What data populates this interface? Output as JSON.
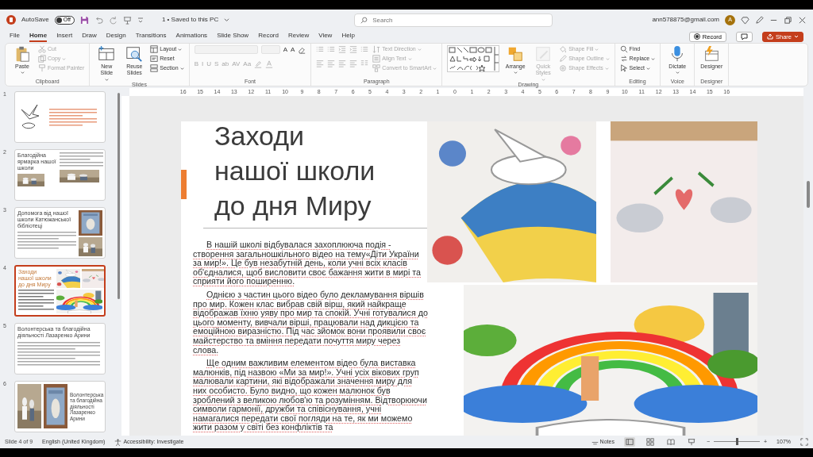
{
  "title_bar": {
    "autosave_label": "AutoSave",
    "autosave": {
      "on": false,
      "label": "Off"
    },
    "document": "1 • Saved to this PC",
    "search": {
      "placeholder": "Search"
    },
    "account": "ann578875@gmail.com",
    "avatar": "A"
  },
  "ribbon_tabs": [
    {
      "label": "File",
      "selected": false
    },
    {
      "label": "Home",
      "selected": true
    },
    {
      "label": "Insert",
      "selected": false
    },
    {
      "label": "Draw",
      "selected": false
    },
    {
      "label": "Design",
      "selected": false
    },
    {
      "label": "Transitions",
      "selected": false
    },
    {
      "label": "Animations",
      "selected": false
    },
    {
      "label": "Slide Show",
      "selected": false
    },
    {
      "label": "Record",
      "selected": false
    },
    {
      "label": "Review",
      "selected": false
    },
    {
      "label": "View",
      "selected": false
    },
    {
      "label": "Help",
      "selected": false
    }
  ],
  "record_button": "Record",
  "share_button": "Share",
  "ribbon_groups": [
    {
      "label": "Clipboard",
      "columns": [
        [
          [
            {
              "kind": "large",
              "label": "Paste",
              "disabled": false,
              "dropdown": true
            }
          ]
        ],
        [
          [
            {
              "kind": "small",
              "label": "Cut",
              "disabled": true
            }
          ],
          [
            {
              "kind": "small",
              "label": "Copy",
              "disabled": true,
              "dropdown": true
            }
          ],
          [
            {
              "kind": "small",
              "label": "Format Painter",
              "disabled": true
            }
          ]
        ]
      ]
    },
    {
      "label": "Slides",
      "columns": [
        [
          [
            {
              "kind": "large",
              "label": "New Slide",
              "disabled": false,
              "dropdown": true
            }
          ]
        ],
        [
          [
            {
              "kind": "large",
              "label": "Reuse Slides",
              "disabled": false
            }
          ]
        ],
        [
          [
            {
              "kind": "small",
              "label": "Layout",
              "disabled": false,
              "dropdown": true
            }
          ],
          [
            {
              "kind": "small",
              "label": "Reset",
              "disabled": false
            }
          ],
          [
            {
              "kind": "small",
              "label": "Section",
              "disabled": false,
              "dropdown": true
            }
          ]
        ]
      ]
    },
    {
      "label": "Font",
      "columns": [
        [
          [
            {
              "kind": "field-wide",
              "disabled": true
            },
            {
              "kind": "field-narrow",
              "disabled": true
            },
            {
              "kind": "glyph",
              "label": "A",
              "disabled": false
            },
            {
              "kind": "glyph",
              "label": "A",
              "disabled": false
            },
            {
              "kind": "clear",
              "disabled": false
            }
          ],
          [
            {
              "kind": "glyph",
              "label": "B",
              "disabled": true
            },
            {
              "kind": "glyph",
              "label": "I",
              "disabled": true
            },
            {
              "kind": "glyph",
              "label": "U",
              "disabled": true
            },
            {
              "kind": "glyph",
              "label": "S",
              "disabled": true
            },
            {
              "kind": "glyph",
              "label": "ab",
              "disabled": true
            },
            {
              "kind": "glyph",
              "label": "AV",
              "disabled": true
            },
            {
              "kind": "glyph",
              "label": "Aa",
              "disabled": true
            },
            {
              "kind": "highlight",
              "disabled": true
            },
            {
              "kind": "font-color",
              "disabled": true
            }
          ]
        ]
      ]
    },
    {
      "label": "Paragraph",
      "columns": [
        [
          [
            {
              "kind": "list",
              "disabled": true
            },
            {
              "kind": "list",
              "disabled": true
            },
            {
              "kind": "indent",
              "disabled": true
            },
            {
              "kind": "indent",
              "disabled": true
            },
            {
              "kind": "list",
              "disabled": true
            }
          ],
          [
            {
              "kind": "align",
              "disabled": true
            },
            {
              "kind": "align",
              "disabled": true
            },
            {
              "kind": "align",
              "disabled": true
            },
            {
              "kind": "align",
              "disabled": true
            },
            {
              "kind": "columns",
              "disabled": true
            }
          ]
        ],
        [
          [
            {
              "kind": "small",
              "label": "Text Direction",
              "disabled": true,
              "dropdown": true
            }
          ],
          [
            {
              "kind": "small",
              "label": "Align Text",
              "disabled": true,
              "dropdown": true
            }
          ],
          [
            {
              "kind": "small",
              "label": "Convert to SmartArt",
              "disabled": true,
              "dropdown": true
            }
          ]
        ]
      ]
    },
    {
      "label": "Drawing",
      "columns": [
        [
          [
            {
              "kind": "gallery",
              "disabled": false
            }
          ]
        ],
        [
          [
            {
              "kind": "large",
              "label": "Arrange",
              "disabled": false,
              "dropdown": true
            }
          ]
        ],
        [
          [
            {
              "kind": "large",
              "label": "Quick Styles",
              "disabled": true,
              "dropdown": true
            }
          ]
        ],
        [
          [
            {
              "kind": "small",
              "label": "Shape Fill",
              "disabled": true,
              "dropdown": true
            }
          ],
          [
            {
              "kind": "small",
              "label": "Shape Outline",
              "disabled": true,
              "dropdown": true
            }
          ],
          [
            {
              "kind": "small",
              "label": "Shape Effects",
              "disabled": true,
              "dropdown": true
            }
          ]
        ]
      ]
    },
    {
      "label": "Editing",
      "columns": [
        [
          [
            {
              "kind": "small",
              "label": "Find",
              "disabled": false
            }
          ],
          [
            {
              "kind": "small",
              "label": "Replace",
              "disabled": false,
              "dropdown": true
            }
          ],
          [
            {
              "kind": "small",
              "label": "Select",
              "disabled": false,
              "dropdown": true
            }
          ]
        ]
      ]
    },
    {
      "label": "Voice",
      "columns": [
        [
          [
            {
              "kind": "large",
              "label": "Dictate",
              "disabled": false,
              "dropdown": true
            }
          ]
        ]
      ]
    },
    {
      "label": "Designer",
      "columns": [
        [
          [
            {
              "kind": "large",
              "label": "Designer",
              "disabled": false
            }
          ]
        ]
      ]
    }
  ],
  "thumbnails": [
    {
      "number": "1",
      "selected": false,
      "kind": "dove"
    },
    {
      "number": "2",
      "selected": false,
      "kind": "title-photos-left",
      "title": "Благодійна ярмарка нашої школи"
    },
    {
      "number": "3",
      "selected": false,
      "kind": "title-photos-right",
      "title": "Допомога від нашої школи Катюжанської бібліотеці"
    },
    {
      "number": "4",
      "selected": true,
      "kind": "current",
      "title": "Заходи нашої школи до дня Миру"
    },
    {
      "number": "5",
      "selected": false,
      "kind": "title-text",
      "title": "Волонтерська та благодійна діяльності Лазаренко Арини"
    },
    {
      "number": "6",
      "selected": false,
      "kind": "photos-title",
      "title": "Волонтерська та благодійна діяльності Лазаренко Арини"
    }
  ],
  "ruler": [
    "16",
    "15",
    "14",
    "13",
    "12",
    "11",
    "10",
    "9",
    "8",
    "7",
    "6",
    "5",
    "4",
    "3",
    "2",
    "1",
    "0",
    "1",
    "2",
    "3",
    "4",
    "5",
    "6",
    "7",
    "8",
    "9",
    "10",
    "11",
    "12",
    "13",
    "14",
    "15",
    "16"
  ],
  "slide": {
    "title": "Заходи нашої школи до дня Миру",
    "paragraphs": [
      "В нашій школі відбувалася захоплююча подія - створення загальношкільного відео на тему«Діти України за мир!». Це був незабутній день, коли учні всіх класів об'єдналися, щоб висловити своє бажання жити в мирі та сприяти його поширенню.",
      "Однією з частин цього відео було декламування віршів про мир. Кожен клас вибрав свій вірш, який найкраще відображав їхню уяву про мир та спокій. Учні готувалися до цього моменту, вивчали вірші, працювали над дикцією та емоційною виразністю. Під час зйомок вони проявили своє майстерство та вміння передати почуття миру через слова.",
      "Ще одним важливим елементом відео була виставка малюнків, під назвою «Ми за мир!». Учні усіх вікових груп малювали картини, які відображали значення миру для них особисто. Було видно, що кожен малюнок був зроблений з великою любов'ю та розумінням. Відтворюючи символи гармонії, дружби та співіснування, учні намагалися передати свої погляди на те, як ми можемо жити разом у світі без конфліктів та"
    ],
    "pictures": [
      {
        "kind": "picture"
      },
      {
        "kind": "picture"
      },
      {
        "kind": "picture"
      }
    ]
  },
  "status_bar": {
    "slide": "Slide 4 of 9",
    "language": "English (United Kingdom)",
    "accessibility": "Accessibility: Investigate",
    "notes": "Notes",
    "views": [
      {
        "selected": true
      },
      {
        "selected": false
      },
      {
        "selected": false
      },
      {
        "selected": false
      }
    ],
    "zoom": {
      "minus": "−",
      "plus": "+",
      "level": 0.5,
      "reading": "107%"
    }
  }
}
